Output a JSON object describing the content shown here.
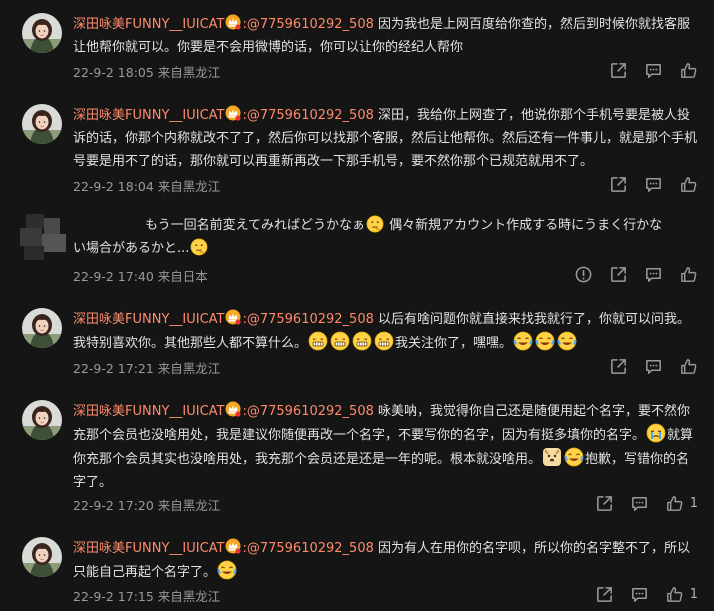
{
  "comments": [
    {
      "user": "深田咏美FUNNY__IUICAT",
      "reply_to": ":@7759610292_508",
      "text": "因为我也是上网百度给你查的，然后到时候你就找客服让他帮你就可以。你要是不会用微博的话，你可以让你的经纪人帮你",
      "time": "22-9-2 18:05 来自黑龙江"
    },
    {
      "user": "深田咏美FUNNY__IUICAT",
      "reply_to": ":@7759610292_508",
      "text": "深田，我给你上网查了，他说你那个手机号要是被人投诉的话，你那个内称就改不了了，然后你可以找那个客服，然后让他帮你。然后还有一件事儿，就是那个手机号要是用不了的话，那你就可以再重新再改一下那手机号，要不然你那个已规范就用不了。",
      "time": "22-9-2 18:04 来自黑龙江"
    },
    {
      "line1": "もう一回名前変えてみればどうかなぁ",
      "line1b": "偶々新規アカウント作成する時にうまく行かな",
      "line2": "い場合があるかと...",
      "time": "22-9-2 17:40 来自日本"
    },
    {
      "user": "深田咏美FUNNY__IUICAT",
      "reply_to": ":@7759610292_508",
      "text_a": "以后有啥问题你就直接来找我就行了，你就可以问我。我特别喜欢你。其他那些人都不算什么。",
      "text_b": "我关注你了，嘿嘿。",
      "time": "22-9-2 17:21 来自黑龙江"
    },
    {
      "user": "深田咏美FUNNY__IUICAT",
      "reply_to": ":@7759610292_508",
      "text_a": "咏美呐，我觉得你自己还是随便用起个名字，要不然你充那个会员也没啥用处，我是建议你随便再改一个名字，不要写你的名字，因为有挺多填你的名字。",
      "text_b": "就算你充那个会员其实也没啥用处，我充那个会员还是还是一年的呢。根本就没啥用。",
      "text_c": "抱歉，写错你的名字了。",
      "time": "22-9-2 17:20 来自黑龙江",
      "likes": "1"
    },
    {
      "user": "深田咏美FUNNY__IUICAT",
      "reply_to": ":@7759610292_508",
      "text": "因为有人在用你的名字呗，所以你的名字整不了，所以只能自己再起个名字了。",
      "time": "22-9-2 17:15 来自黑龙江",
      "likes": "1"
    }
  ],
  "icons": {
    "share": "share-icon",
    "comment": "comment-icon",
    "like": "like-icon",
    "report": "report-icon",
    "crown": "crown-badge-icon"
  },
  "colors": {
    "background": "#151515",
    "username": "#ff8a6a",
    "text": "#e2e2e2",
    "meta": "#9a9a9a"
  }
}
